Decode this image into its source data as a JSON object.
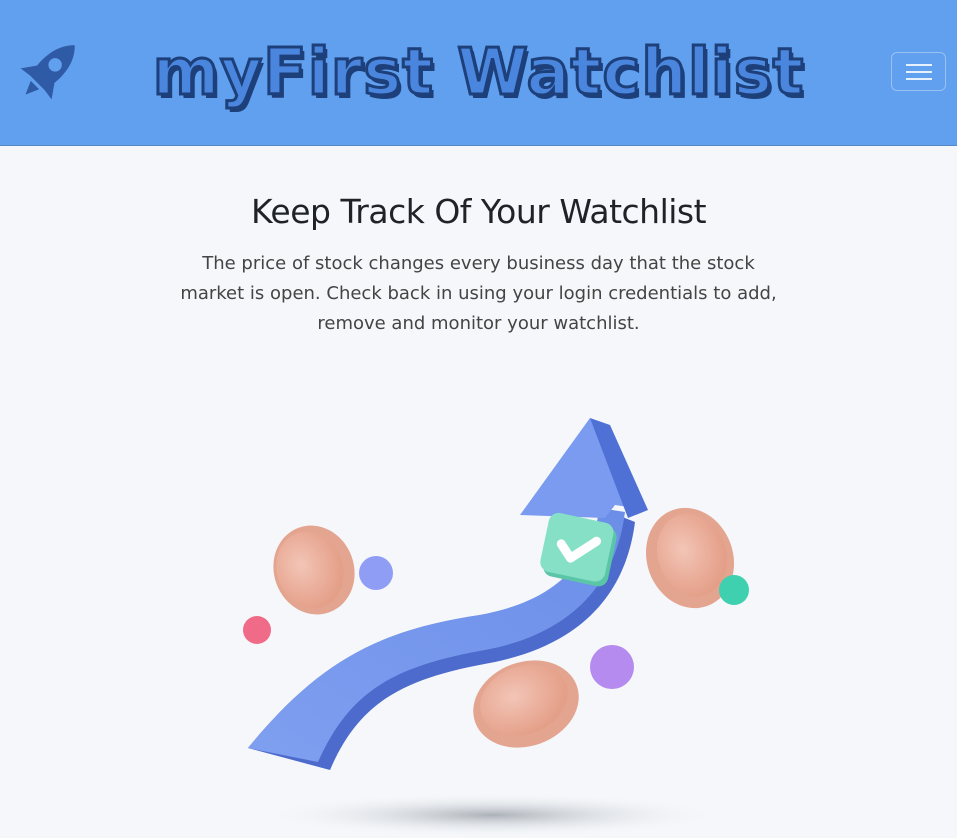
{
  "navbar": {
    "brand": "myFirst Watchlist",
    "logo_icon": "rocket-icon",
    "toggle_icon": "hamburger-menu-icon",
    "background": "#61a0ee"
  },
  "hero": {
    "title": "Keep Track Of Your Watchlist",
    "description": "The price of stock changes every business day that the stock market is open. Check back in using your login credentials to add, remove and monitor your watchlist."
  },
  "illustration": {
    "icon": "rising-arrow-coins-illustration",
    "badge_icon": "checkmark-icon",
    "arrow_color": "#5c7fe0",
    "coin_color": "#eab3a1",
    "badge_color": "#7ddcc0"
  }
}
